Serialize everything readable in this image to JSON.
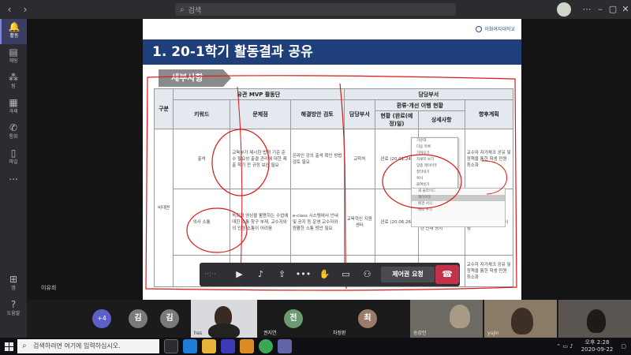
{
  "titlebar": {
    "search_placeholder": "검색"
  },
  "rail": [
    {
      "label": "활동",
      "icon": "bell-icon"
    },
    {
      "label": "채팅",
      "icon": "chat-icon"
    },
    {
      "label": "팀",
      "icon": "teams-icon"
    },
    {
      "label": "과제",
      "icon": "assignments-icon"
    },
    {
      "label": "통화",
      "icon": "phone-icon"
    },
    {
      "label": "파일",
      "icon": "file-icon"
    },
    {
      "label": "...",
      "icon": "more-icon"
    },
    {
      "label": "앱",
      "icon": "apps-icon"
    },
    {
      "label": "도움말",
      "icon": "help-icon"
    }
  ],
  "slide": {
    "logo_text": "이화여자대학교",
    "title": "1. 20-1학기 활동결과 공유",
    "section": "세부사항",
    "header_group_1": "유관 MVP 활동단",
    "header_group_2": "담당부서",
    "header_subgroup": "환류·개선 이행 현황",
    "col_gubun": "구분",
    "col_keyword": "키워드",
    "col_problem": "문제점",
    "col_solution": "해결방안 검토",
    "col_dept": "담당부서",
    "col_status": "현황 (완료(예정)일)",
    "col_detail": "상세사항",
    "col_plan": "향후계획",
    "row_group": "비대면",
    "row1_keyword": "출석",
    "row1_problem": "교육부가 제시한 법적 기준 준수 필요성 출결 관리에 대한 제출 학기 전 규정 보완 필요",
    "row1_solution": "온라인 강의 출석 확인 방법 검토 필요",
    "row1_dept": "교학처",
    "row1_status": "완료 (20.01.24)",
    "row1_plan": "교수자 자가체크 공유 및 정책을 통한 학생 민원 최소화",
    "row2_keyword": "의사 소통",
    "row2_problem": "녹화형 영상을 활용하는 수업에 대한 소통 창구 부재, 교수자와의 인원 소통이 어려움",
    "row2_solution": "e-class 시스템에서 안내 및 공지 등 운영 교수자와 원활한 소통 방안 필요",
    "row2_dept": "교육혁신 지원센터",
    "row2_status": "완료 (20.06.26)",
    "row2_detail": "e-class 활용 매뉴얼 보완 e-class 이용 관련 안내 공지",
    "row2_plan": "e-class 활용 시 제작 가이드 설명 및 교육 시행",
    "row3_plan": "교수자 자가체크 공유 및 정책을 통한 학생 민원 최소화"
  },
  "dropdown_items": [
    "가운데",
    "다음 목록",
    "가져오기",
    "자세히 보기",
    "맞춤 레이아웃",
    "잘라내기",
    "복사",
    "붙여넣기"
  ],
  "context_items": [
    "새 슬라이드",
    "레이아웃",
    "배경 서식",
    "메모 추가"
  ],
  "controls": {
    "share_label": "제어권 요청",
    "timer": "··:··"
  },
  "presenter_name": "이유희",
  "participants": {
    "more": "+4",
    "initials": [
      "김",
      "김",
      "전",
      "최"
    ],
    "tiles": [
      "hss",
      "권지연",
      "차정환",
      "송강민",
      "yujin"
    ]
  },
  "taskbar": {
    "search_placeholder": "검색하려면 여기에 입력하십시오.",
    "time": "오후 2:28",
    "date": "2020-09-22"
  }
}
